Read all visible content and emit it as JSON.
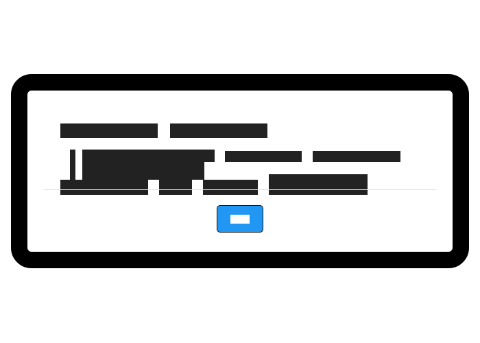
{
  "dialog": {
    "heading_redacted": true,
    "message_redacted": true,
    "ok_button": {
      "label": "",
      "label_redacted": true
    }
  },
  "colors": {
    "frame": "#000000",
    "background": "#ffffff",
    "redaction": "#222222",
    "button": "#2196f3",
    "button_label_mask": "#ffffff",
    "divider": "#e0e0e0"
  }
}
